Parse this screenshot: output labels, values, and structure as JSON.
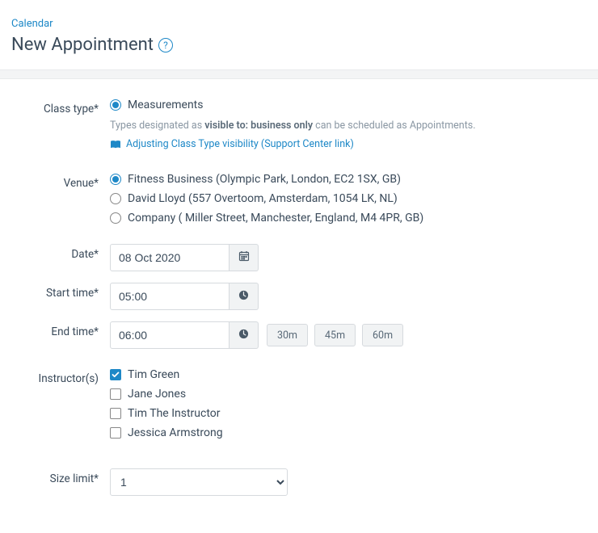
{
  "breadcrumb": {
    "calendar": "Calendar"
  },
  "title": "New Appointment",
  "labels": {
    "class_type": "Class type*",
    "venue": "Venue*",
    "date": "Date*",
    "start_time": "Start time*",
    "end_time": "End time*",
    "instructors": "Instructor(s)",
    "size_limit": "Size limit*"
  },
  "class_type": {
    "options": [
      {
        "label": "Measurements",
        "selected": true
      }
    ],
    "helper_prefix": "Types designated as ",
    "helper_strong": "visible to: business only",
    "helper_suffix": " can be scheduled as Appointments.",
    "support_link": "Adjusting Class Type visibility (Support Center link)"
  },
  "venues": [
    {
      "label": "Fitness Business (Olympic Park, London, EC2 1SX, GB)",
      "selected": true
    },
    {
      "label": "David Lloyd (557 Overtoom, Amsterdam, 1054 LK, NL)",
      "selected": false
    },
    {
      "label": "Company ( Miller Street, Manchester, England, M4 4PR, GB)",
      "selected": false
    }
  ],
  "date": "08 Oct 2020",
  "start_time": "05:00",
  "end_time": "06:00",
  "duration_presets": [
    "30m",
    "45m",
    "60m"
  ],
  "instructors_list": [
    {
      "name": "Tim Green",
      "checked": true
    },
    {
      "name": "Jane Jones",
      "checked": false
    },
    {
      "name": "Tim The Instructor",
      "checked": false
    },
    {
      "name": "Jessica Armstrong",
      "checked": false
    }
  ],
  "size_limit": "1"
}
